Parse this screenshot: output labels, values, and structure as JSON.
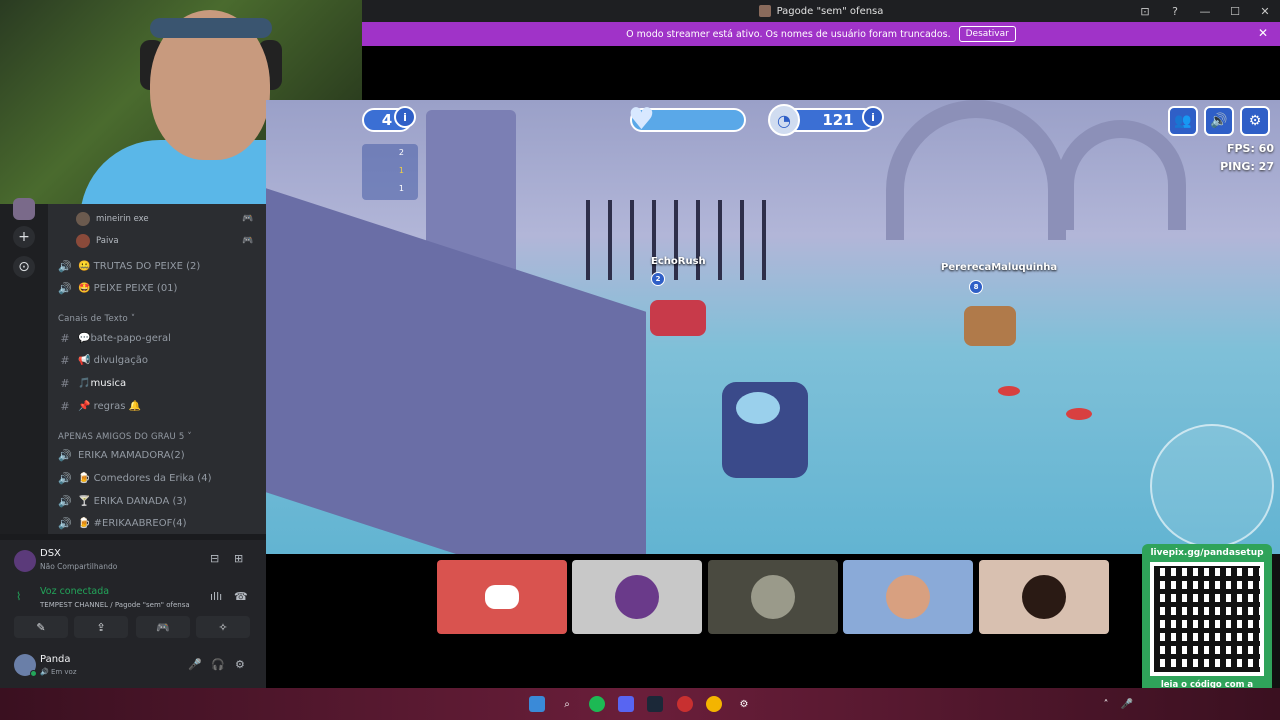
{
  "window": {
    "title": "Pagode \"sem\" ofensa",
    "controls": [
      "⊡",
      "?",
      "—",
      "☐",
      "✕"
    ]
  },
  "banner": {
    "message": "O modo streamer está ativo. Os nomes de usuário foram truncados.",
    "button": "Desativar",
    "close": "✕"
  },
  "sidebar": {
    "server_buttons": [
      "+",
      "⊙"
    ],
    "users_in_voice": [
      {
        "name": "mineirin exe",
        "game_icon": "🎮"
      },
      {
        "name": "Paiva",
        "game_icon": "🎮"
      }
    ],
    "voice_channels_top": [
      {
        "label": "🤐 TRUTAS DO PEIXE (2)",
        "icon": "🔊"
      },
      {
        "label": "🤩 PEIXE PEIXE (01)",
        "icon": "🔊"
      }
    ],
    "text_category": "Canais de Texto ˅",
    "text_channels": [
      {
        "label": "💬bate-papo-geral",
        "icon": "#"
      },
      {
        "label": "📢 divulgação",
        "icon": "#"
      },
      {
        "label": "🎵musica",
        "icon": "#",
        "active": true
      },
      {
        "label": "📌 regras 🔔",
        "icon": "#"
      }
    ],
    "voice_category": "APENAS AMIGOS DO GRAU 5 ˅",
    "voice_channels": [
      {
        "label": "ERIKA MAMADORA(2)",
        "icon": "🔊"
      },
      {
        "label": "🍺 Comedores da Erika (4)",
        "icon": "🔊"
      },
      {
        "label": "🍸 ERIKA DANADA (3)",
        "icon": "🔊"
      },
      {
        "label": "🍺 #ERIKAABREOF(4)",
        "icon": "🔊"
      }
    ]
  },
  "panel": {
    "activity_name": "DSX",
    "activity_status": "Não Compartilhando",
    "voice_status": "Voz conectada",
    "voice_channel": "TEMPEST CHANNEL / Pagode \"sem\" ofensa",
    "buttons": [
      "✎",
      "⇪",
      "🎮",
      "✧"
    ],
    "username": "Panda",
    "user_status": "🔊 Em voz",
    "user_controls": [
      "🎤",
      "🎧",
      "⚙"
    ]
  },
  "game": {
    "lap_number": "4",
    "timer": "121",
    "info_icon": "i",
    "ranks": [
      "2",
      "1",
      "1"
    ],
    "fps": "FPS: 60",
    "ping": "PING: 27",
    "player1": "EchoRush",
    "player1_badge": "2",
    "player2": "PererecaMaluquinha",
    "player2_badge": "8",
    "buttons": [
      "👥",
      "🔊",
      "⚙"
    ]
  },
  "qr": {
    "url": "livepix.gg/pandasetup",
    "hint": "leia o código com a câmera do celular."
  },
  "colors": {
    "banner": "#a033c8",
    "discord_red": "#d9534f",
    "online_green": "#23a55a",
    "qr_bg": "#2fa35a"
  }
}
